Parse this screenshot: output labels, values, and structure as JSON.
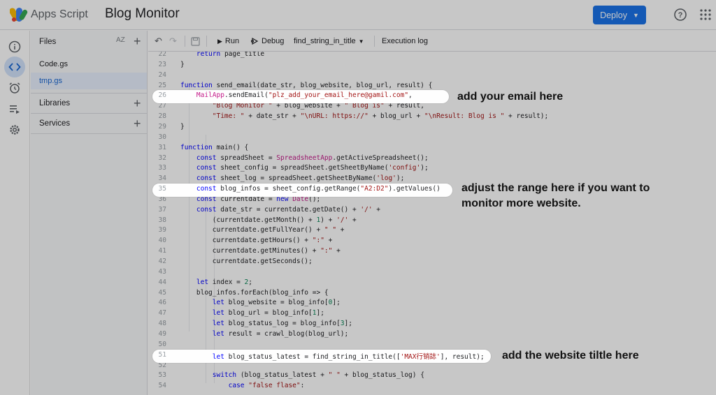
{
  "header": {
    "app_name": "Apps Script",
    "project_title": "Blog Monitor",
    "deploy_label": "Deploy"
  },
  "files_panel": {
    "files_title": "Files",
    "sort_label": "AZ",
    "files": [
      "Code.gs",
      "tmp.gs"
    ],
    "libraries_label": "Libraries",
    "services_label": "Services"
  },
  "toolbar": {
    "run_label": "Run",
    "debug_label": "Debug",
    "function_select": "find_string_in_title",
    "execution_log_label": "Execution log"
  },
  "code": {
    "line_numbers": [
      "22",
      "23",
      "24",
      "25",
      "26",
      "27",
      "28",
      "29",
      "30",
      "31",
      "32",
      "33",
      "34",
      "35",
      "36",
      "37",
      "38",
      "39",
      "40",
      "41",
      "42",
      "43",
      "44",
      "45",
      "46",
      "47",
      "48",
      "49",
      "50",
      "51",
      "52",
      "53",
      "54"
    ],
    "lines": [
      "    return page_title",
      "}",
      "",
      "function send_email(date_str, blog_website, blog_url, result) {",
      "    MailApp.sendEmail(\"plz_add_your_email_here@gamil.com\",",
      "        \"Blog Monitor \" + blog_website + \" Blog is\" + result,",
      "        \"Time: \" + date_str + \"\\nURL: https://\" + blog_url + \"\\nResult: Blog is \" + result);",
      "}",
      "",
      "function main() {",
      "    const spreadSheet = SpreadsheetApp.getActiveSpreadsheet();",
      "    const sheet_config = spreadSheet.getSheetByName('config');",
      "    const sheet_log = spreadSheet.getSheetByName('log');",
      "    const blog_infos = sheet_config.getRange(\"A2:D2\").getValues()",
      "    const currentdate = new Date();",
      "    const date_str = currentdate.getDate() + '/' +",
      "        (currentdate.getMonth() + 1) + '/' +",
      "        currentdate.getFullYear() + \" \" +",
      "        currentdate.getHours() + \":\" +",
      "        currentdate.getMinutes() + \":\" +",
      "        currentdate.getSeconds();",
      "",
      "    let index = 2;",
      "    blog_infos.forEach(blog_info => {",
      "        let blog_website = blog_info[0];",
      "        let blog_url = blog_info[1];",
      "        let blog_status_log = blog_info[3];",
      "        let result = crawl_blog(blog_url);",
      "",
      "        let blog_status_latest = find_string_in_title(['MAX行销誌'], result);",
      "",
      "        switch (blog_status_latest + \" \" + blog_status_log) {",
      "            case \"false flase\":"
    ]
  },
  "annotations": {
    "email": "add your email here",
    "range_line1": "adjust the range here if you want to",
    "range_line2": "monitor more website.",
    "title": "add the website tiltle here"
  },
  "colors": {
    "accent": "#1a73e8",
    "selected_bg": "#e8f0fe",
    "keyword": "#0000ff",
    "string": "#a31515"
  }
}
